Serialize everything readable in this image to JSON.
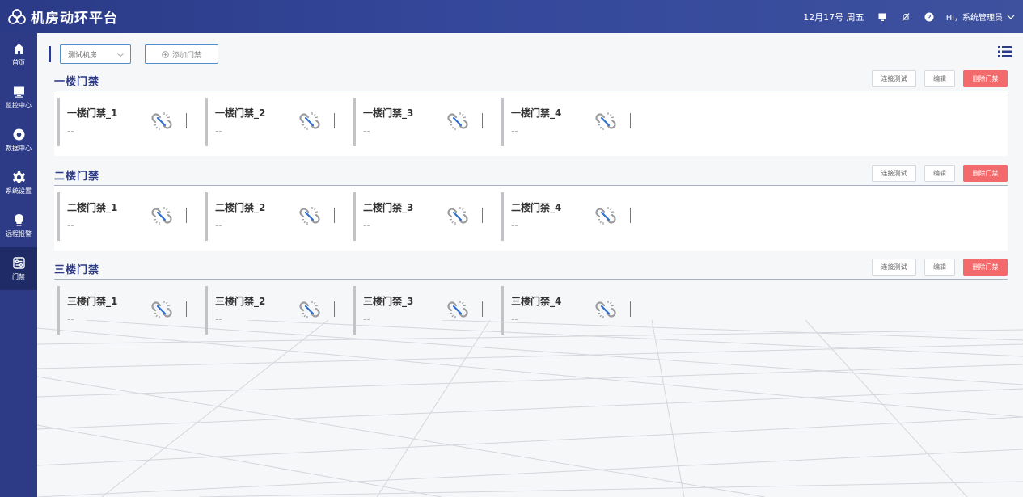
{
  "header": {
    "title": "机房动环平台",
    "date": "12月17号 周五",
    "user": "Hi，系统管理员"
  },
  "sidebar": {
    "items": [
      {
        "label": "首页",
        "icon": "home-icon"
      },
      {
        "label": "监控中心",
        "icon": "monitor-icon"
      },
      {
        "label": "数据中心",
        "icon": "data-icon"
      },
      {
        "label": "系统设置",
        "icon": "gear-icon"
      },
      {
        "label": "远程报警",
        "icon": "alarm-icon"
      },
      {
        "label": "门禁",
        "icon": "door-icon"
      }
    ],
    "active": "门禁"
  },
  "toolbar": {
    "select_value": "测试机房",
    "add_label": "添加门禁"
  },
  "section_buttons": {
    "test": "连接测试",
    "edit": "编辑",
    "delete": "删除门禁"
  },
  "sections": [
    {
      "title": "一楼门禁",
      "doors": [
        {
          "name": "一楼门禁_1",
          "value": "--"
        },
        {
          "name": "一楼门禁_2",
          "value": "--"
        },
        {
          "name": "一楼门禁_3",
          "value": "--"
        },
        {
          "name": "一楼门禁_4",
          "value": "--"
        }
      ]
    },
    {
      "title": "二楼门禁",
      "doors": [
        {
          "name": "二楼门禁_1",
          "value": "--"
        },
        {
          "name": "二楼门禁_2",
          "value": "--"
        },
        {
          "name": "二楼门禁_3",
          "value": "--"
        },
        {
          "name": "二楼门禁_4",
          "value": "--"
        }
      ]
    },
    {
      "title": "三楼门禁",
      "doors": [
        {
          "name": "三楼门禁_1",
          "value": "--"
        },
        {
          "name": "三楼门禁_2",
          "value": "--"
        },
        {
          "name": "三楼门禁_3",
          "value": "--"
        },
        {
          "name": "三楼门禁_4",
          "value": "--"
        }
      ]
    }
  ],
  "colors": {
    "brand": "#2d3b87",
    "danger": "#f26a6b",
    "link": "#2f6fd1"
  }
}
